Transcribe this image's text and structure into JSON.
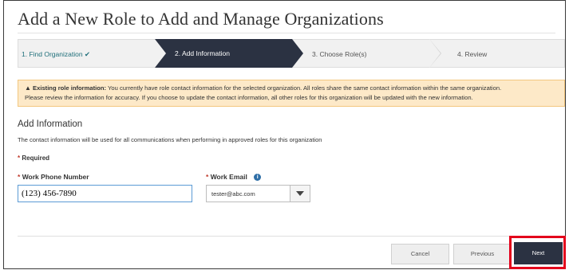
{
  "page": {
    "title": "Add a New Role to Add and Manage Organizations"
  },
  "steps": [
    {
      "label": "1. Find Organization ✔",
      "state": "completed"
    },
    {
      "label": "2. Add Information",
      "state": "active"
    },
    {
      "label": "3. Choose Role(s)",
      "state": "upcoming"
    },
    {
      "label": "4. Review",
      "state": "upcoming"
    }
  ],
  "alert": {
    "icon": "warning-icon",
    "heading": "Existing role information:",
    "line1": "You currently have role contact information for the selected organization. All roles share the same contact information within the same organization.",
    "line2": "Please review the information for accuracy. If you choose to update the contact information, all other roles for this organization will be updated with the new information."
  },
  "section": {
    "title": "Add Information",
    "description": "The contact information will be used for all communications when performing in approved roles for this organization",
    "required_label": "Required"
  },
  "form": {
    "phone_label": "Work Phone Number",
    "phone_value": "(123) 456-7890",
    "email_label": "Work Email",
    "email_value": "tester@abc.com"
  },
  "footer": {
    "cancel_label": "Cancel",
    "previous_label": "Previous",
    "next_label": "Next"
  },
  "colors": {
    "active_step": "#2b3242",
    "alert_bg": "#fde9c8",
    "highlight": "#e3001b",
    "required": "#c0392b"
  }
}
